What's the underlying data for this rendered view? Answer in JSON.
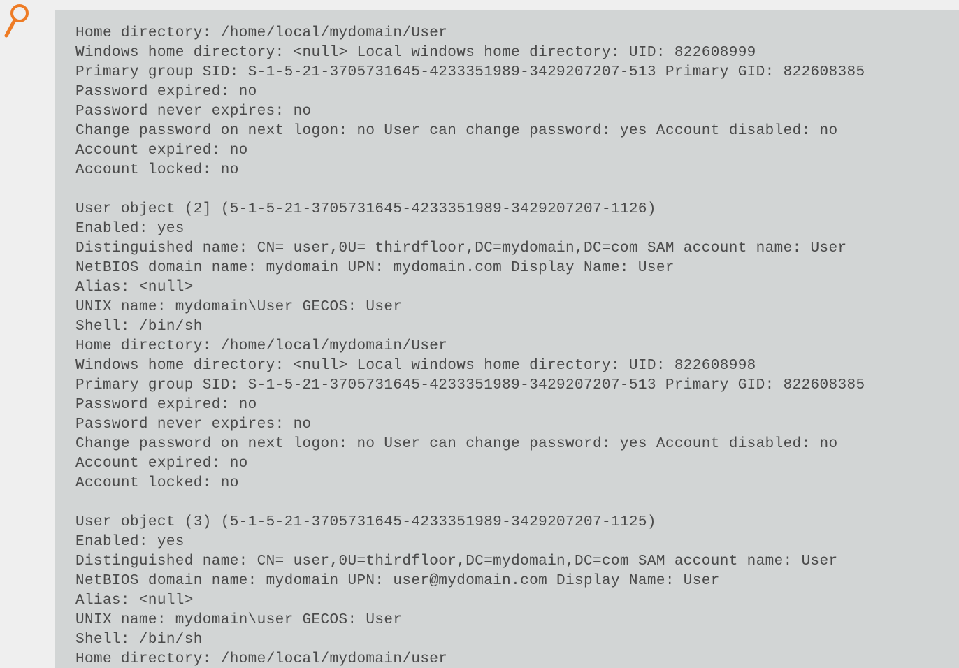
{
  "icon": {
    "name": "magnifier-icon",
    "color": "#ee7b24"
  },
  "colors": {
    "page_background": "#efefef",
    "panel_background": "#d2d5d5",
    "text": "#4a4a4a"
  },
  "code_block": {
    "lines": [
      "Home directory: /home/local/mydomain/User",
      "Windows home directory: <null> Local windows home directory: UID: 822608999",
      "Primary group SID: S-1-5-21-3705731645-4233351989-3429207207-513 Primary GID: 822608385",
      "Password expired: no",
      "Password never expires: no",
      "Change password on next logon: no User can change password: yes Account disabled: no",
      "Account expired: no",
      "Account locked: no",
      "",
      "User object (2] (5-1-5-21-3705731645-4233351989-3429207207-1126)",
      "Enabled: yes",
      "Distinguished name: CN= user,0U= thirdfloor,DC=mydomain,DC=com SAM account name: User",
      "NetBIOS domain name: mydomain UPN: mydomain.com Display Name: User",
      "Alias: <null>",
      "UNIX name: mydomain\\User GECOS: User",
      "Shell: /bin/sh",
      "Home directory: /home/local/mydomain/User",
      "Windows home directory: <null> Local windows home directory: UID: 822608998",
      "Primary group SID: S-1-5-21-3705731645-4233351989-3429207207-513 Primary GID: 822608385",
      "Password expired: no",
      "Password never expires: no",
      "Change password on next logon: no User can change password: yes Account disabled: no",
      "Account expired: no",
      "Account locked: no",
      "",
      "User object (3) (5-1-5-21-3705731645-4233351989-3429207207-1125)",
      "Enabled: yes",
      "Distinguished name: CN= user,0U=thirdfloor,DC=mydomain,DC=com SAM account name: User",
      "NetBIOS domain name: mydomain UPN: user@mydomain.com Display Name: User",
      "Alias: <null>",
      "UNIX name: mydomain\\user GECOS: User",
      "Shell: /bin/sh",
      "Home directory: /home/local/mydomain/user"
    ]
  }
}
